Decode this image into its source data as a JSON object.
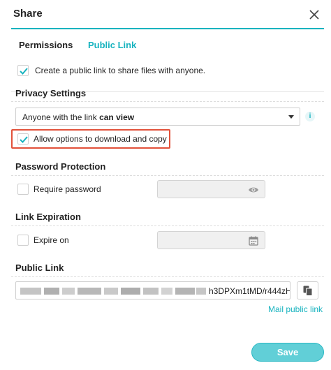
{
  "dialog": {
    "title": "Share"
  },
  "tabs": [
    {
      "label": "Permissions",
      "active": false
    },
    {
      "label": "Public Link",
      "active": true
    }
  ],
  "public_link_option": {
    "label": "Create a public link to share files with anyone.",
    "checked": true
  },
  "privacy": {
    "heading": "Privacy Settings",
    "select_prefix": "Anyone with the link ",
    "select_value": "can view",
    "info_icon": "info-icon",
    "allow_download": {
      "label": "Allow options to download and copy",
      "checked": true
    }
  },
  "password": {
    "heading": "Password Protection",
    "require_label": "Require password",
    "checked": false,
    "field_icon": "eye-icon"
  },
  "expiration": {
    "heading": "Link Expiration",
    "expire_label": "Expire on",
    "checked": false,
    "field_icon": "calendar-icon"
  },
  "public_link": {
    "heading": "Public Link",
    "visible_suffix": "h3DPXm1tMD/r444zH",
    "copy_icon": "copy-icon",
    "mail_label": "Mail public link"
  },
  "footer": {
    "save_label": "Save"
  },
  "colors": {
    "accent": "#17b3bf",
    "save_bg": "#61cfd7",
    "highlight": "#e2513a"
  }
}
